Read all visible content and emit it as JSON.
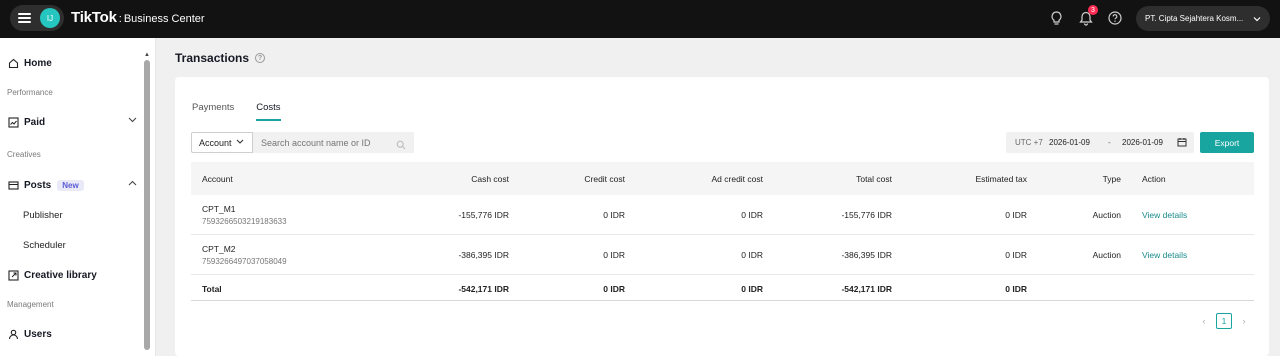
{
  "topbar": {
    "avatar_initials": "IJ",
    "brand_logo": "TikTok",
    "brand_sep": ":",
    "brand_sub": "Business Center",
    "notification_count": "3",
    "account_name": "PT. Cipta Sejahtera Kosm...",
    "icons": [
      "hamburger-icon",
      "lightbulb-icon",
      "bell-icon",
      "help-icon",
      "chevron-down-icon"
    ]
  },
  "sidebar": {
    "home": "Home",
    "section_performance": "Performance",
    "paid": "Paid",
    "section_creatives": "Creatives",
    "posts": "Posts",
    "posts_badge": "New",
    "publisher": "Publisher",
    "scheduler": "Scheduler",
    "creative_library": "Creative library",
    "section_management": "Management",
    "users": "Users"
  },
  "page": {
    "title": "Transactions",
    "help_glyph": "?"
  },
  "tabs": [
    "Payments",
    "Costs"
  ],
  "active_tab": "Costs",
  "filters": {
    "account_select": "Account",
    "search_placeholder": "Search account name or ID",
    "timezone": "UTC +7",
    "date_start": "2026-01-09",
    "date_sep": "-",
    "date_end": "2026-01-09",
    "export_label": "Export"
  },
  "table": {
    "headers": {
      "account": "Account",
      "cash_cost": "Cash cost",
      "credit_cost": "Credit cost",
      "ad_credit_cost": "Ad credit cost",
      "total_cost": "Total cost",
      "estimated_tax": "Estimated tax",
      "type": "Type",
      "action": "Action"
    },
    "rows": [
      {
        "account_name": "CPT_M1",
        "account_id": "7593266503219183633",
        "cash_cost": "-155,776 IDR",
        "credit_cost": "0 IDR",
        "ad_credit_cost": "0 IDR",
        "total_cost": "-155,776 IDR",
        "estimated_tax": "0 IDR",
        "type": "Auction",
        "action": "View details"
      },
      {
        "account_name": "CPT_M2",
        "account_id": "7593266497037058049",
        "cash_cost": "-386,395 IDR",
        "credit_cost": "0 IDR",
        "ad_credit_cost": "0 IDR",
        "total_cost": "-386,395 IDR",
        "estimated_tax": "0 IDR",
        "type": "Auction",
        "action": "View details"
      }
    ],
    "total": {
      "label": "Total",
      "cash_cost": "-542,171 IDR",
      "credit_cost": "0 IDR",
      "ad_credit_cost": "0 IDR",
      "total_cost": "-542,171 IDR",
      "estimated_tax": "0 IDR"
    }
  },
  "pagination": {
    "prev": "‹",
    "current_page": "1",
    "next": "›"
  },
  "colors": {
    "accent": "#18a5a0",
    "topbar": "#121212",
    "badge": "#fe2c55"
  }
}
